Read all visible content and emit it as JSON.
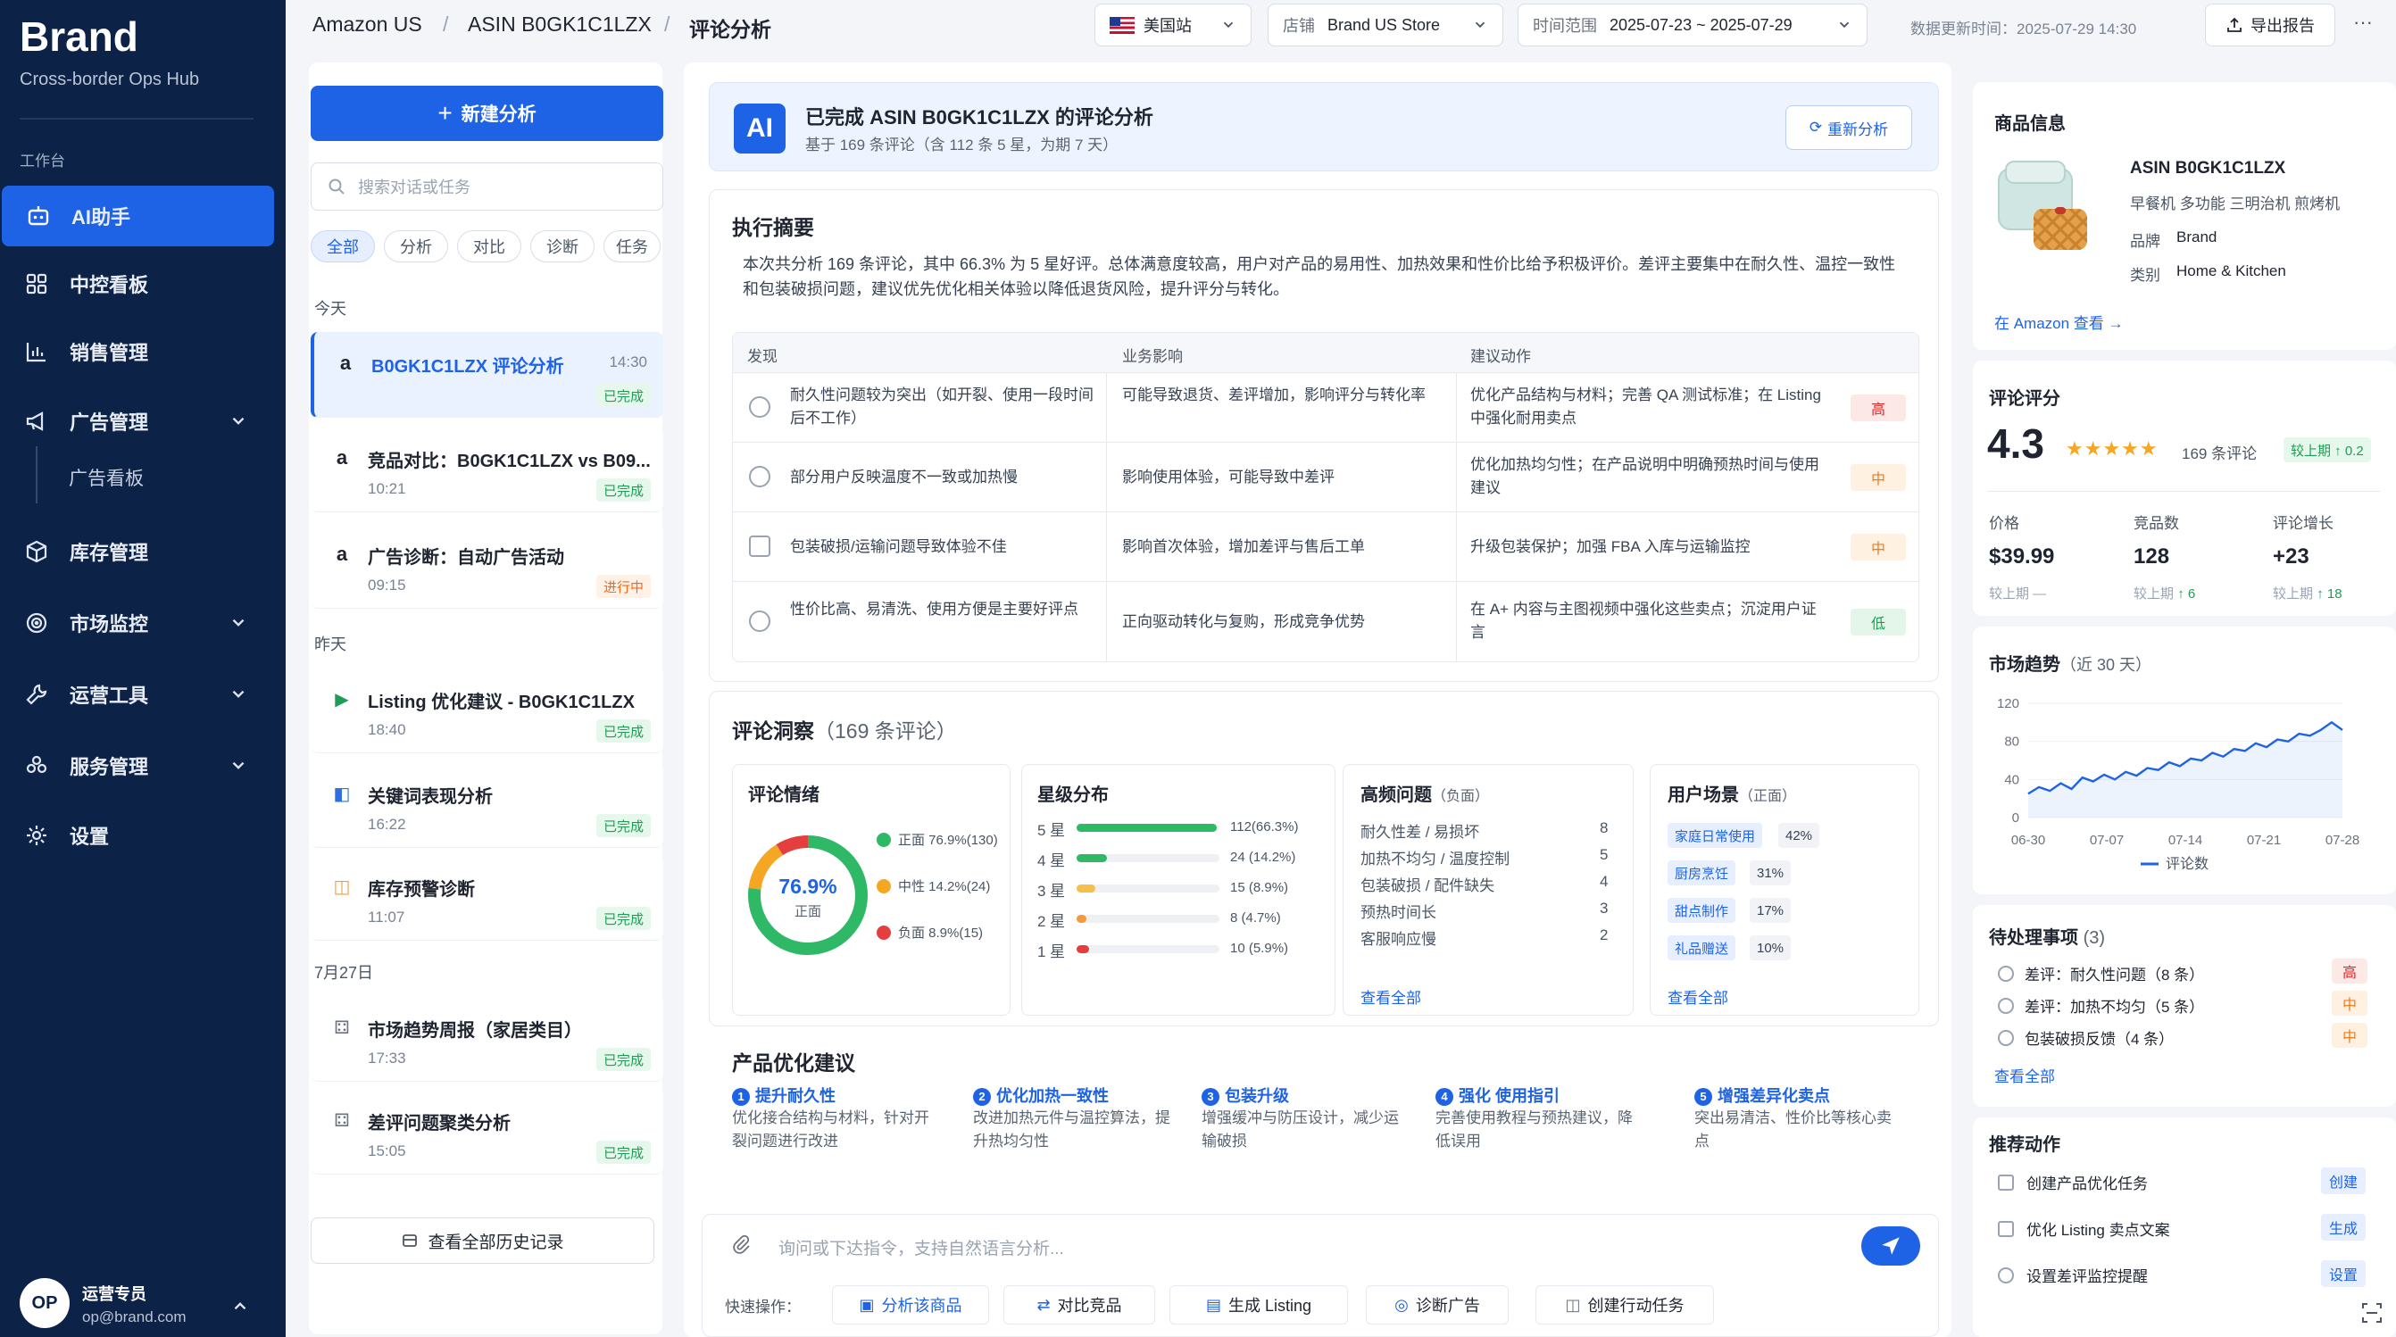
{
  "sidebar": {
    "brand": "Brand",
    "subtitle": "Cross-border Ops Hub",
    "section": "工作台",
    "items": [
      {
        "label": "AI助手"
      },
      {
        "label": "中控看板"
      },
      {
        "label": "销售管理"
      },
      {
        "label": "广告管理"
      },
      {
        "label": "广告看板"
      },
      {
        "label": "库存管理"
      },
      {
        "label": "市场监控"
      },
      {
        "label": "运营工具"
      },
      {
        "label": "服务管理"
      },
      {
        "label": "设置"
      }
    ],
    "user": {
      "initials": "OP",
      "name": "运营专员",
      "email": "op@brand.com"
    }
  },
  "topbar": {
    "crumbs": [
      "Amazon US",
      "/",
      "ASIN B0GK1C1LZX",
      "/",
      "评论分析"
    ],
    "site": "美国站",
    "store_label": "店铺",
    "store": "Brand US Store",
    "range_label": "时间范围",
    "range": "2025-07-23 ~ 2025-07-29",
    "updated": "数据更新时间：2025-07-29 14:30",
    "export": "导出报告",
    "more": "···"
  },
  "left": {
    "new": "新建分析",
    "search_ph": "搜索对话或任务",
    "chips": [
      "全部",
      "分析",
      "对比",
      "诊断",
      "任务"
    ],
    "days": [
      "今天",
      "昨天",
      "7月27日"
    ],
    "convs": [
      {
        "icon": "a",
        "title": "B0GK1C1LZX 评论分析",
        "time": "14:30",
        "meta": "",
        "status": "已完成"
      },
      {
        "icon": "a",
        "title": "竞品对比：B0GK1C1LZX vs B09...",
        "time": "",
        "meta": "10:21",
        "status": "已完成"
      },
      {
        "icon": "a",
        "title": "广告诊断：自动广告活动",
        "time": "",
        "meta": "09:15",
        "status": "进行中"
      },
      {
        "icon": "▶",
        "title": "Listing 优化建议 - B0GK1C1LZX",
        "time": "",
        "meta": "18:40",
        "status": "已完成"
      },
      {
        "icon": "◧",
        "title": "关键词表现分析",
        "time": "",
        "meta": "16:22",
        "status": "已完成"
      },
      {
        "icon": "◫",
        "title": "库存预警诊断",
        "time": "",
        "meta": "11:07",
        "status": "已完成"
      },
      {
        "icon": "⚃",
        "title": "市场趋势周报（家居类目）",
        "time": "",
        "meta": "17:33",
        "status": "已完成"
      },
      {
        "icon": "⚃",
        "title": "差评问题聚类分析",
        "time": "",
        "meta": "15:05",
        "status": "已完成"
      }
    ],
    "history": "查看全部历史记录"
  },
  "ai": {
    "icon": "AI",
    "title": "已完成 ASIN B0GK1C1LZX 的评论分析",
    "sub": "基于 169 条评论（含 112 条 5 星，为期 7 天）",
    "reanalyze": "重新分析"
  },
  "summary": {
    "title": "执行摘要",
    "text": "本次共分析 169 条评论，其中 66.3% 为 5 星好评。总体满意度较高，用户对产品的易用性、加热效果和性价比给予积极评价。差评主要集中在耐久性、温控一致性和包装破损问题，建议优先优化相关体验以降低退货风险，提升评分与转化。",
    "headers": [
      "发现",
      "业务影响",
      "建议动作"
    ],
    "rows": [
      {
        "f": "耐久性问题较为突出（如开裂、使用一段时间后不工作）",
        "i": "可能导致退货、差评增加，影响评分与转化率",
        "a": "优化产品结构与材料；完善 QA 测试标准；在 Listing 中强化耐用卖点",
        "lvl": "高"
      },
      {
        "f": "部分用户反映温度不一致或加热慢",
        "i": "影响使用体验，可能导致中差评",
        "a": "优化加热均匀性；在产品说明中明确预热时间与使用建议",
        "lvl": "中"
      },
      {
        "f": "包装破损/运输问题导致体验不佳",
        "i": "影响首次体验，增加差评与售后工单",
        "a": "升级包装保护；加强 FBA 入库与运输监控",
        "lvl": "中"
      },
      {
        "f": "性价比高、易清洗、使用方便是主要好评点",
        "i": "正向驱动转化与复购，形成竞争优势",
        "a": "在 A+ 内容与主图视频中强化这些卖点；沉淀用户证言",
        "lvl": "低"
      }
    ]
  },
  "insight": {
    "title": "评论洞察",
    "count": "（169 条评论）",
    "sentiment": {
      "title": "评论情绪",
      "center": "76.9%",
      "center_sub": "正面",
      "pos": 76.9,
      "neu": 14.2,
      "neg": 8.9,
      "legend": [
        "正面  76.9%(130)",
        "中性  14.2%(24)",
        "负面  8.9%(15)"
      ]
    },
    "stars": {
      "title": "星级分布",
      "rows": [
        {
          "l": "5 星",
          "v": "112(66.3%)",
          "p": 66.3
        },
        {
          "l": "4 星",
          "v": "24 (14.2%)",
          "p": 14.2
        },
        {
          "l": "3 星",
          "v": "15 (8.9%)",
          "p": 8.9
        },
        {
          "l": "2 星",
          "v": "8 (4.7%)",
          "p": 4.7
        },
        {
          "l": "1 星",
          "v": "10 (5.9%)",
          "p": 5.9
        }
      ]
    },
    "issues": {
      "title": "高频问题",
      "tag": "（负面）",
      "rows": [
        {
          "l": "耐久性差 / 易损坏",
          "v": "8"
        },
        {
          "l": "加热不均匀 / 温度控制",
          "v": "5"
        },
        {
          "l": "包装破损 / 配件缺失",
          "v": "4"
        },
        {
          "l": "预热时间长",
          "v": "3"
        },
        {
          "l": "客服响应慢",
          "v": "2"
        }
      ],
      "more": "查看全部"
    },
    "scenes": {
      "title": "用户场景",
      "tag": "（正面）",
      "rows": [
        {
          "l": "家庭日常使用",
          "v": "42%"
        },
        {
          "l": "厨房烹饪",
          "v": "31%"
        },
        {
          "l": "甜点制作",
          "v": "17%"
        },
        {
          "l": "礼品赠送",
          "v": "10%"
        }
      ],
      "more": "查看全部"
    }
  },
  "suggest": {
    "title": "产品优化建议",
    "items": [
      {
        "n": "1",
        "t": "提升耐久性",
        "d": "优化接合结构与材料，针对开裂问题进行改进"
      },
      {
        "n": "2",
        "t": "优化加热一致性",
        "d": "改进加热元件与温控算法，提升热均匀性"
      },
      {
        "n": "3",
        "t": "包装升级",
        "d": "增强缓冲与防压设计，减少运输破损"
      },
      {
        "n": "4",
        "t": "强化 使用指引",
        "d": "完善使用教程与预热建议，降低误用"
      },
      {
        "n": "5",
        "t": "增强差异化卖点",
        "d": "突出易清洁、性价比等核心卖点"
      }
    ]
  },
  "input": {
    "placeholder": "询问或下达指令，支持自然语言分析...",
    "quick_label": "快速操作：",
    "quick": [
      "分析该商品",
      "对比竞品",
      "生成 Listing",
      "诊断广告",
      "创建行动任务"
    ]
  },
  "product": {
    "title": "商品信息",
    "asin": "ASIN B0GK1C1LZX",
    "name": "早餐机 多功能 三明治机 煎烤机",
    "brand_label": "品牌",
    "brand": "Brand",
    "cat_label": "类别",
    "cat": "Home & Kitchen",
    "link": "在 Amazon 查看"
  },
  "rating": {
    "title": "评论评分",
    "score": "4.3",
    "reviews": "169 条评论",
    "delta": "较上期 ↑ 0.2",
    "stats": [
      {
        "l": "价格",
        "v": "$39.99",
        "s": "较上期 —",
        "up": ""
      },
      {
        "l": "竞品数",
        "v": "128",
        "s": "较上期",
        "up": "↑ 6"
      },
      {
        "l": "评论增长",
        "v": "+23",
        "s": "较上期",
        "up": "↑ 18"
      }
    ]
  },
  "trend": {
    "title": "市场趋势",
    "range": "（近 30 天）",
    "legend": "评论数"
  },
  "chart_data": {
    "type": "line",
    "x": [
      "06-30",
      "07-07",
      "07-14",
      "07-21",
      "07-28"
    ],
    "yticks": [
      "120",
      "80",
      "40",
      "0"
    ],
    "ylim": [
      0,
      120
    ],
    "series": [
      {
        "name": "评论数",
        "values": [
          25,
          32,
          28,
          36,
          30,
          42,
          38,
          45,
          40,
          48,
          44,
          52,
          50,
          58,
          54,
          62,
          60,
          68,
          64,
          72,
          70,
          78,
          74,
          82,
          80,
          88,
          86,
          92,
          100,
          92
        ]
      }
    ]
  },
  "todo": {
    "title": "待处理事项",
    "count": "(3)",
    "items": [
      {
        "t": "差评：耐久性问题（8 条）",
        "lvl": "高"
      },
      {
        "t": "差评：加热不均匀（5 条）",
        "lvl": "中"
      },
      {
        "t": "包装破损反馈（4 条）",
        "lvl": "中"
      }
    ],
    "more": "查看全部"
  },
  "actions": {
    "title": "推荐动作",
    "items": [
      {
        "t": "创建产品优化任务",
        "b": "创建"
      },
      {
        "t": "优化 Listing 卖点文案",
        "b": "生成"
      },
      {
        "t": "设置差评监控提醒",
        "b": "设置"
      }
    ]
  }
}
